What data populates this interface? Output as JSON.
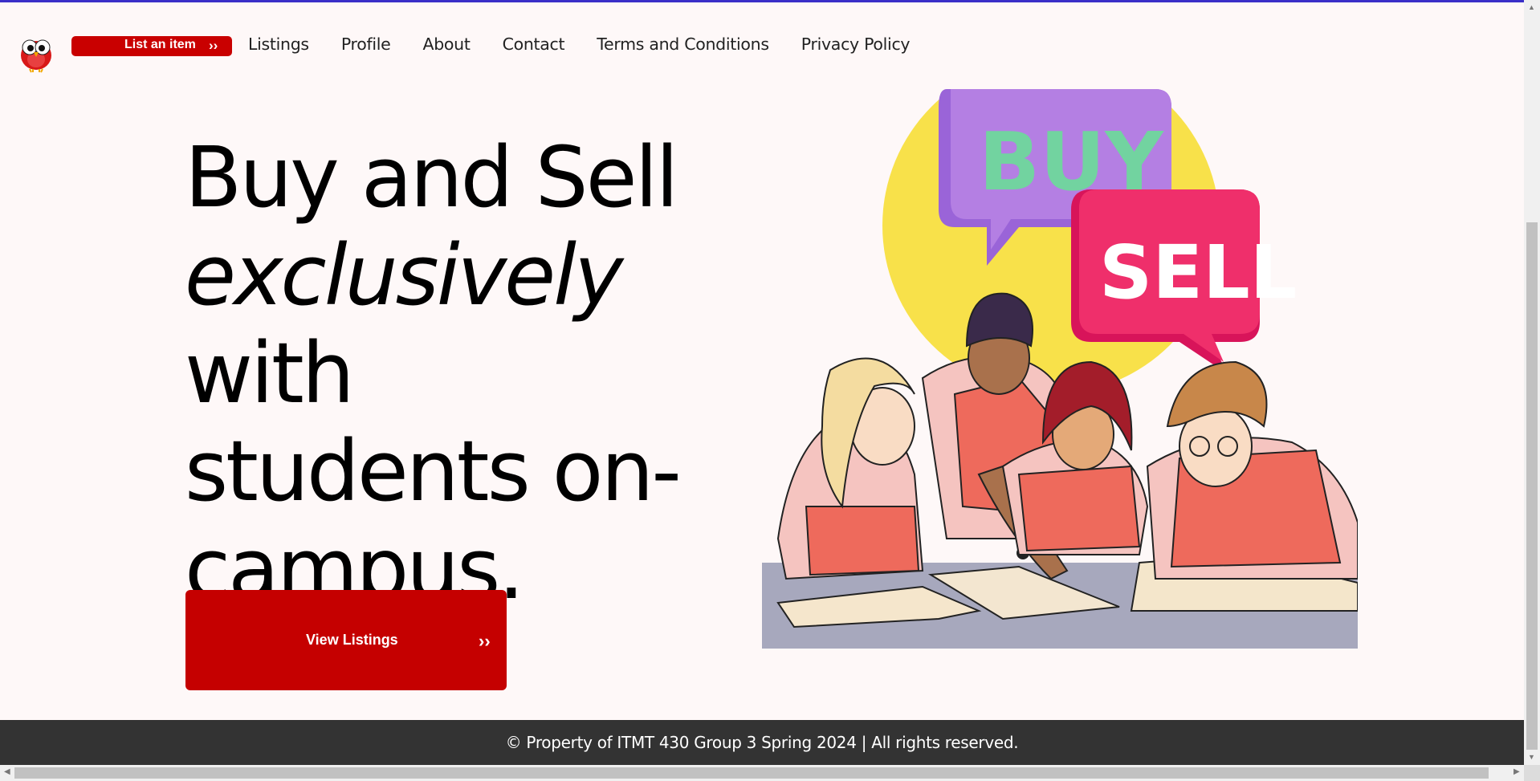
{
  "nav": {
    "list_item_label": "List an item",
    "list_item_chevron": "››",
    "links": [
      "Listings",
      "Profile",
      "About",
      "Contact",
      "Terms and Conditions",
      "Privacy Policy"
    ]
  },
  "hero": {
    "line1": "Buy and Sell",
    "line2_em": "exclusively",
    "line2_rest": " with",
    "line3": "students on-",
    "line4": "campus.",
    "button_label": "View Listings",
    "button_chevron": "››"
  },
  "illustration": {
    "bubble_buy": "BUY",
    "bubble_sell": "SELL"
  },
  "footer": {
    "text": "© Property of ITMT 430 Group 3 Spring 2024 | All rights reserved."
  },
  "colors": {
    "accent_red": "#c50000",
    "footer_bg": "#333333",
    "page_bg": "#fef8f8",
    "top_line": "#3a2fc8"
  }
}
